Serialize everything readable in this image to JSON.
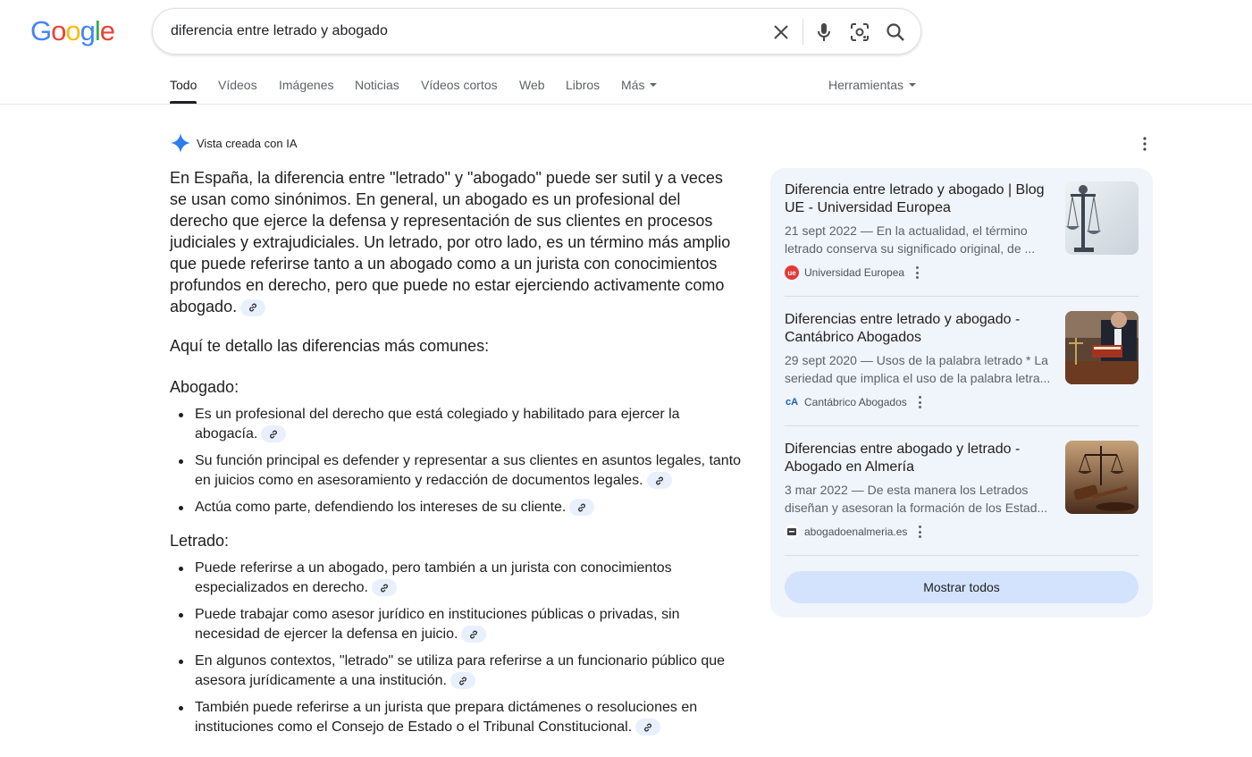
{
  "logo": {
    "letters": [
      "G",
      "o",
      "o",
      "g",
      "l",
      "e"
    ],
    "colors": [
      "#4285f4",
      "#ea4335",
      "#fbbc05",
      "#4285f4",
      "#34a853",
      "#ea4335"
    ]
  },
  "search": {
    "query": "diferencia entre letrado y abogado",
    "icons": [
      "close-icon",
      "mic-icon",
      "lens-icon",
      "search-icon"
    ]
  },
  "tabs": [
    {
      "label": "Todo",
      "active": true
    },
    {
      "label": "Vídeos"
    },
    {
      "label": "Imágenes"
    },
    {
      "label": "Noticias"
    },
    {
      "label": "Vídeos cortos"
    },
    {
      "label": "Web"
    },
    {
      "label": "Libros"
    },
    {
      "label": "Más",
      "dropdown": true
    }
  ],
  "tools_label": "Herramientas",
  "ai": {
    "label": "Vista creada con IA",
    "intro": "En España, la diferencia entre \"letrado\" y \"abogado\" puede ser sutil y a veces se usan como sinónimos. En general, un abogado es un profesional del derecho que ejerce la defensa y representación de sus clientes en procesos judiciales y extrajudiciales. Un letrado, por otro lado, es un término más amplio que puede referirse tanto a un abogado como a un jurista con conocimientos profundos en derecho, pero que puede no estar ejerciendo activamente como abogado.",
    "intro2": "Aquí te detallo las diferencias más comunes:",
    "sections": [
      {
        "heading": "Abogado:",
        "items": [
          "Es un profesional del derecho que está colegiado y habilitado para ejercer la abogacía.",
          "Su función principal es defender y representar a sus clientes en asuntos legales, tanto en juicios como en asesoramiento y redacción de documentos legales.",
          "Actúa como parte, defendiendo los intereses de su cliente."
        ]
      },
      {
        "heading": "Letrado:",
        "items": [
          "Puede referirse a un abogado, pero también a un jurista con conocimientos especializados en derecho.",
          "Puede trabajar como asesor jurídico en instituciones públicas o privadas, sin necesidad de ejercer la defensa en juicio.",
          "En algunos contextos, \"letrado\" se utiliza para referirse a un funcionario público que asesora jurídicamente a una institución.",
          "También puede referirse a un jurista que prepara dictámenes o resoluciones en instituciones como el Consejo de Estado o el Tribunal Constitucional."
        ]
      }
    ]
  },
  "sources": [
    {
      "title": "Diferencia entre letrado y abogado | Blog UE - Universidad Europea",
      "snippet": "21 sept 2022 — En la actualidad, el término letrado conserva su significado original, de ...",
      "site": "Universidad Europea",
      "favicon_text": "ue",
      "favicon_color": "#e53935",
      "thumb": "scales-of-justice"
    },
    {
      "title": "Diferencias entre letrado y abogado - Cantábrico Abogados",
      "snippet": "29 sept 2020 — Usos de la palabra letrado * La seriedad que implica el uso de la palabra letra...",
      "site": "Cantábrico Abogados",
      "favicon_text": "cA",
      "favicon_color": "#1a5fa8",
      "thumb": "lawyer-reading-book"
    },
    {
      "title": "Diferencias entre abogado y letrado - Abogado en Almería",
      "snippet": "3 mar 2022 — De esta manera los Letrados diseñan y asesoran la formación de los Estad...",
      "site": "abogadoenalmeria.es",
      "favicon_text": "",
      "favicon_color": "#3c4043",
      "thumb": "judge-gavel"
    }
  ],
  "show_all_label": "Mostrar todos"
}
